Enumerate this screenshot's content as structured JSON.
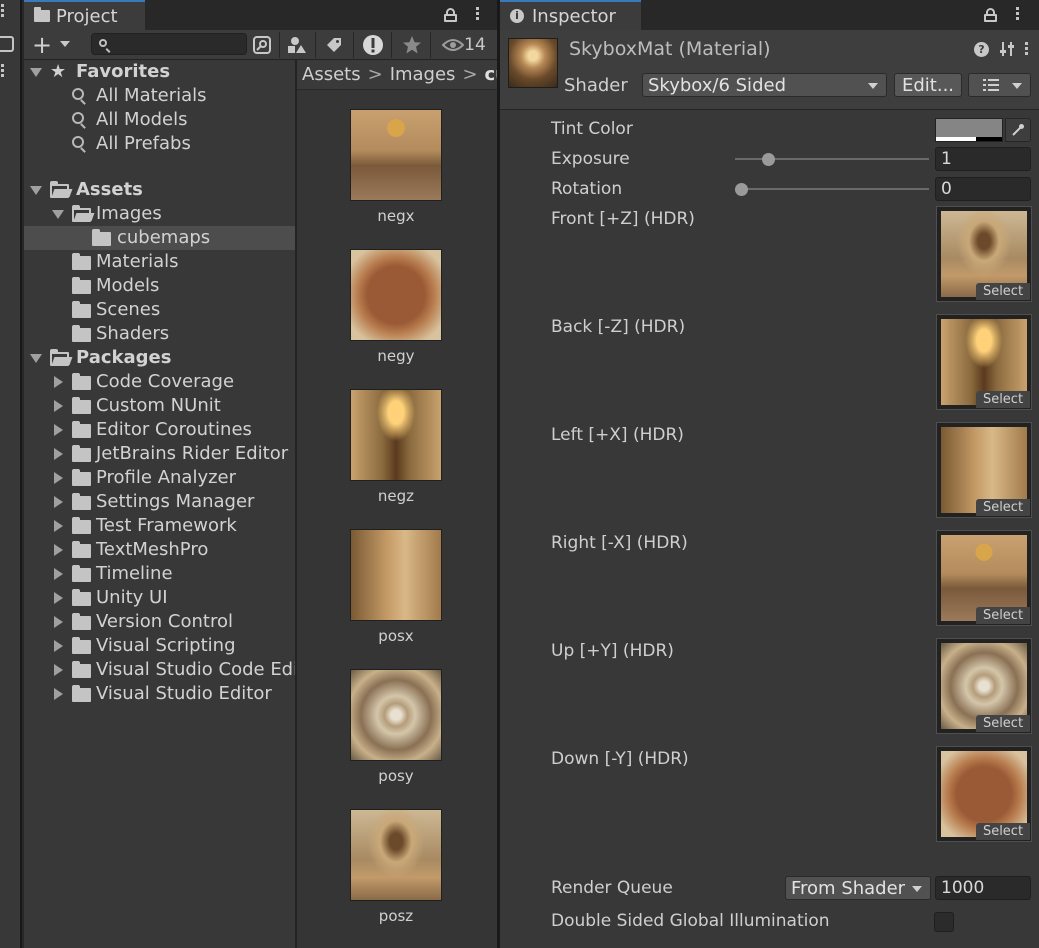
{
  "project": {
    "tab_label": "Project",
    "search_placeholder": "",
    "hidden_count": "14",
    "breadcrumbs": [
      "Assets",
      "Images",
      "cu"
    ],
    "favorites": {
      "title": "Favorites",
      "items": [
        "All Materials",
        "All Models",
        "All Prefabs"
      ]
    },
    "assets": {
      "title": "Assets",
      "images_label": "Images",
      "cubemaps_label": "cubemaps",
      "folders": [
        "Materials",
        "Models",
        "Scenes",
        "Shaders"
      ]
    },
    "packages": {
      "title": "Packages",
      "items": [
        "Code Coverage",
        "Custom NUnit",
        "Editor Coroutines",
        "JetBrains Rider Editor",
        "Profile Analyzer",
        "Settings Manager",
        "Test Framework",
        "TextMeshPro",
        "Timeline",
        "Unity UI",
        "Version Control",
        "Visual Scripting",
        "Visual Studio Code Edi",
        "Visual Studio Editor"
      ]
    },
    "grid_assets": [
      "negx",
      "negy",
      "negz",
      "posx",
      "posy",
      "posz"
    ]
  },
  "inspector": {
    "tab_label": "Inspector",
    "material_title": "SkyboxMat (Material)",
    "shader_label": "Shader",
    "shader_value": "Skybox/6 Sided",
    "edit_button": "Edit...",
    "tint_label": "Tint Color",
    "exposure_label": "Exposure",
    "exposure_value": "1",
    "exposure_fraction": 0.15,
    "rotation_label": "Rotation",
    "rotation_value": "0",
    "rotation_fraction": 0.0,
    "textures": [
      {
        "label": "Front [+Z]   (HDR)",
        "select": "Select"
      },
      {
        "label": "Back [-Z]   (HDR)",
        "select": "Select"
      },
      {
        "label": "Left [+X]   (HDR)",
        "select": "Select"
      },
      {
        "label": "Right [-X]   (HDR)",
        "select": "Select"
      },
      {
        "label": "Up [+Y]   (HDR)",
        "select": "Select"
      },
      {
        "label": "Down [-Y]   (HDR)",
        "select": "Select"
      }
    ],
    "render_queue_label": "Render Queue",
    "render_queue_mode": "From Shader",
    "render_queue_value": "1000",
    "double_sided_label": "Double Sided Global Illumination",
    "double_sided_checked": false
  },
  "colors": {
    "tab_accent": "#3a79bb",
    "panel_bg": "#383838",
    "selected_row": "#4d4d4d"
  }
}
